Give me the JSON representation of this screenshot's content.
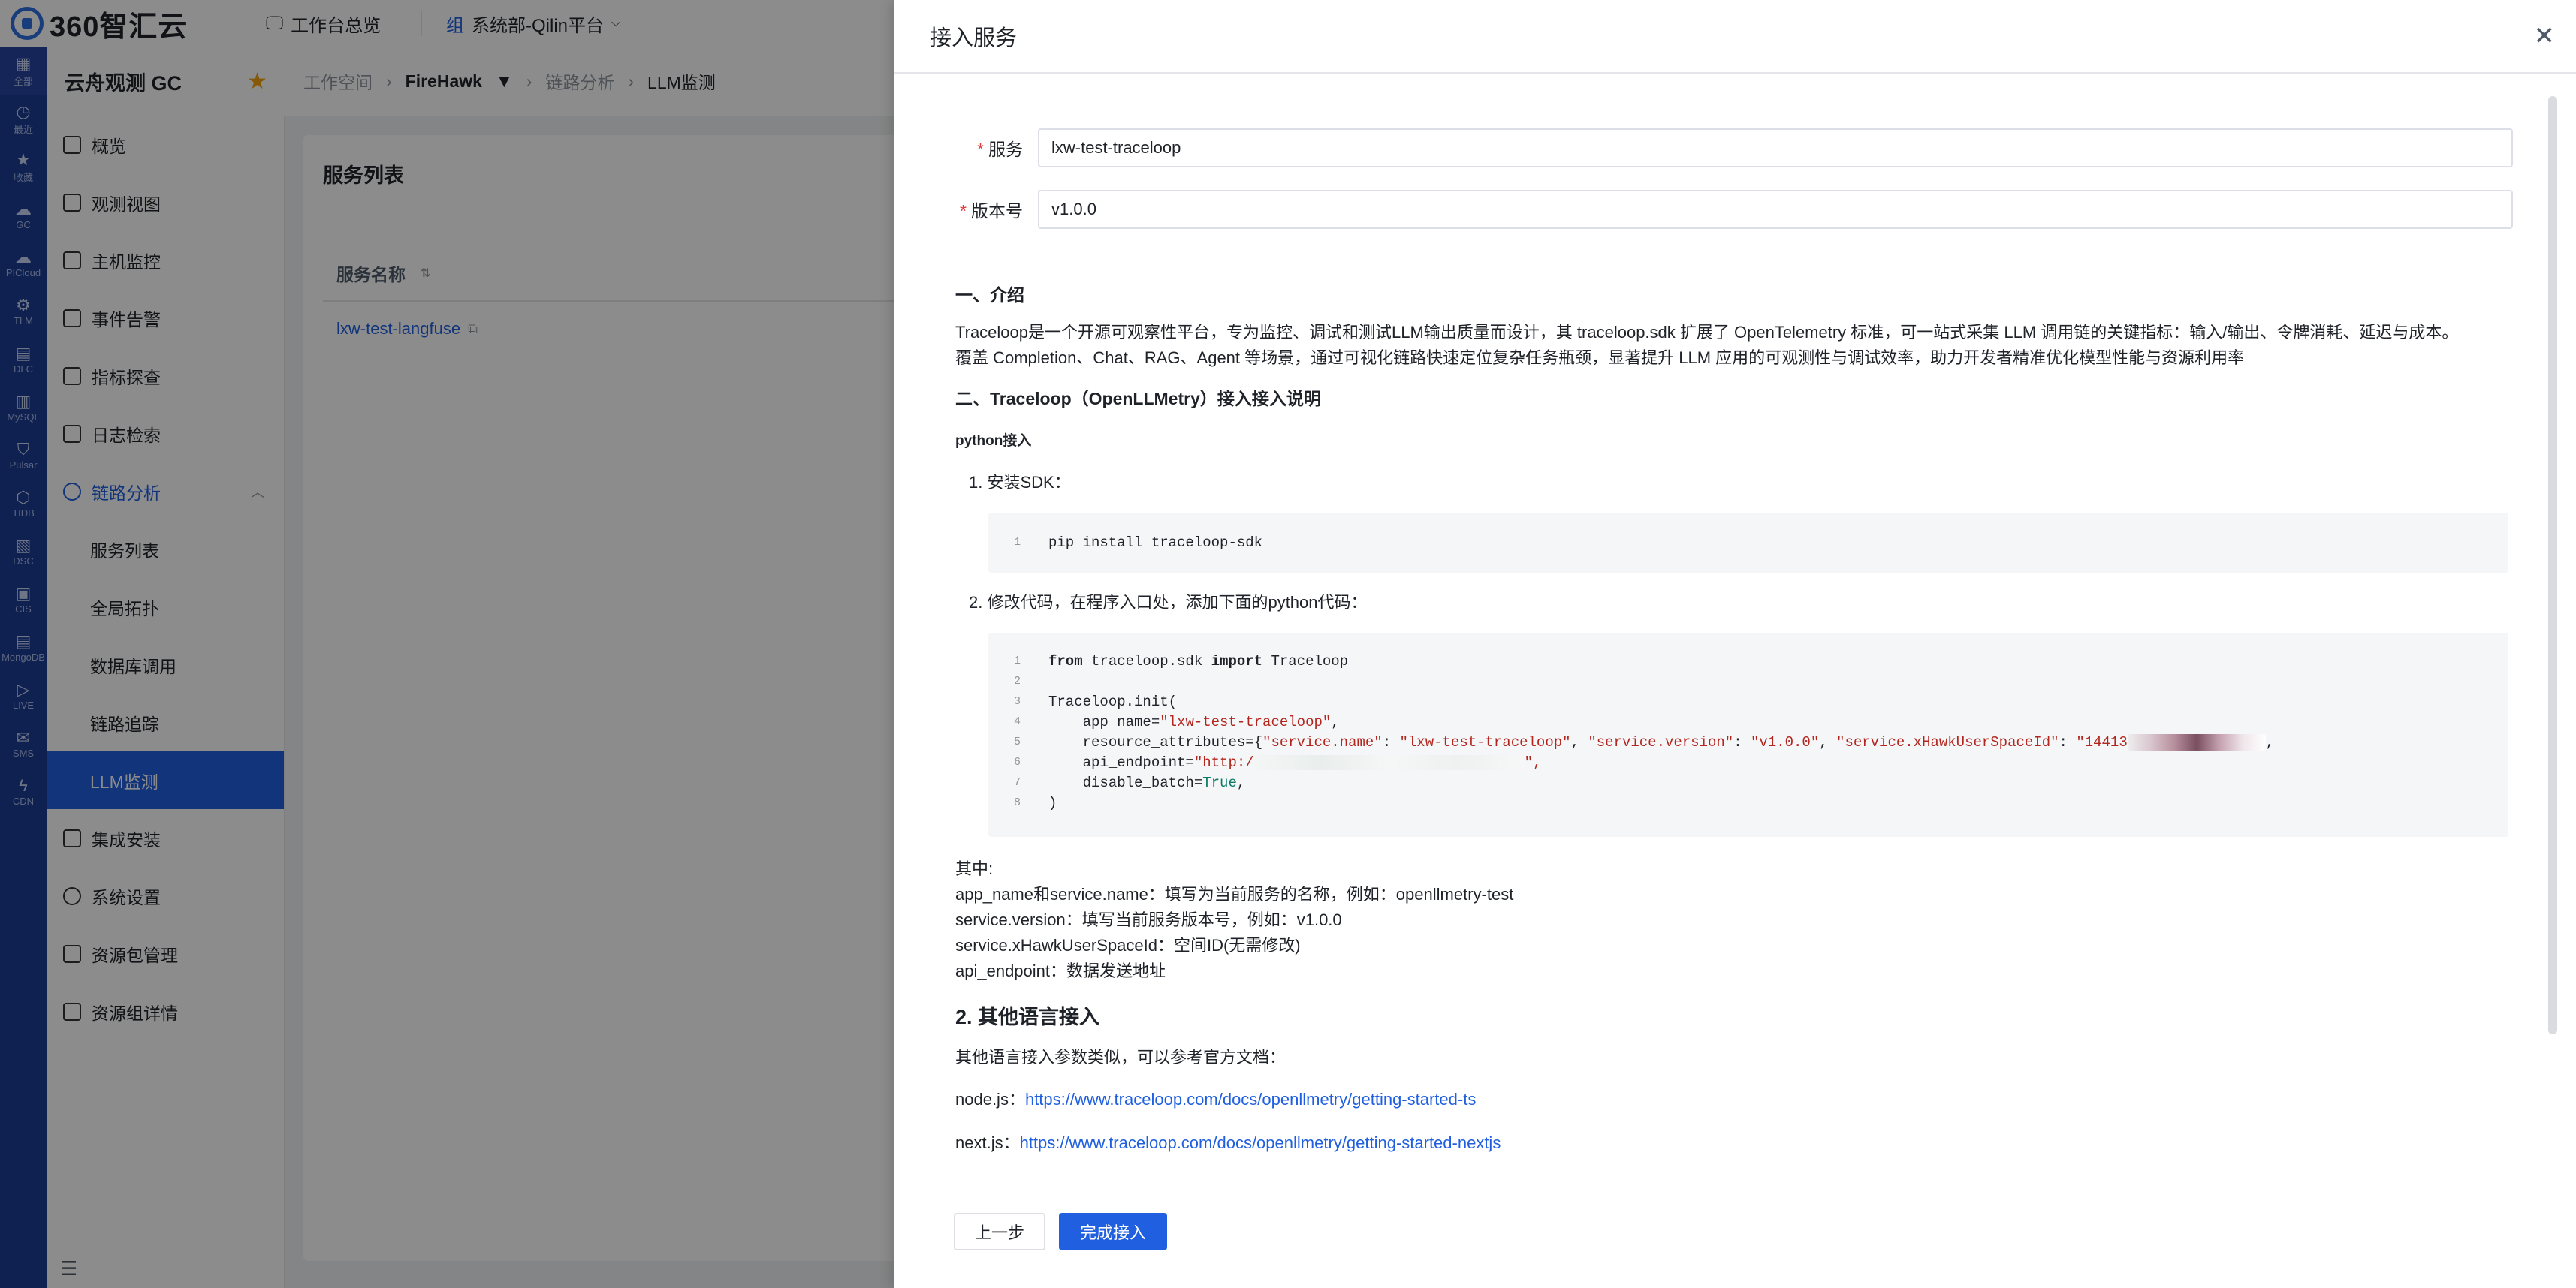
{
  "topbar": {
    "logo_text": "360智汇云",
    "workbench": "工作台总览",
    "dept": "系统部-Qilin平台"
  },
  "rail": [
    {
      "icon": "grid-icon",
      "label": "全部"
    },
    {
      "icon": "clock-icon",
      "label": "最近"
    },
    {
      "icon": "star-icon",
      "label": "收藏"
    },
    {
      "icon": "cloud-icon",
      "label": "GC"
    },
    {
      "icon": "cloud-icon",
      "label": "PICloud"
    },
    {
      "icon": "gear-icon",
      "label": "TLM"
    },
    {
      "icon": "db-icon",
      "label": "DLC"
    },
    {
      "icon": "db-icon",
      "label": "MySQL"
    },
    {
      "icon": "shield-icon",
      "label": "Pulsar"
    },
    {
      "icon": "cube-icon",
      "label": "TIDB"
    },
    {
      "icon": "chart-icon",
      "label": "DSC"
    },
    {
      "icon": "box-icon",
      "label": "CIS"
    },
    {
      "icon": "db-icon",
      "label": "MongoDB"
    },
    {
      "icon": "play-icon",
      "label": "LIVE"
    },
    {
      "icon": "message-icon",
      "label": "SMS"
    },
    {
      "icon": "bolt-icon",
      "label": "CDN"
    }
  ],
  "sidebar": {
    "title": "云舟观测 GC",
    "items": [
      "概览",
      "观测视图",
      "主机监控",
      "事件告警",
      "指标探查",
      "日志检索"
    ],
    "group": "链路分析",
    "subitems": [
      "服务列表",
      "全局拓扑",
      "数据库调用",
      "链路追踪",
      "LLM监测"
    ],
    "items_after": [
      "集成安装",
      "系统设置",
      "资源包管理",
      "资源组详情"
    ]
  },
  "main": {
    "crumbs": [
      "工作空间",
      "FireHawk",
      "链路分析",
      "LLM监测"
    ],
    "card_title": "服务列表",
    "col_service": "服务名称",
    "row_service": "lxw-test-langfuse"
  },
  "drawer": {
    "title": "接入服务",
    "service_label": "服务",
    "service_value": "lxw-test-traceloop",
    "version_label": "版本号",
    "version_value": "v1.0.0",
    "sec1_title": "一、介绍",
    "intro_1": "Traceloop是一个开源可观察性平台，专为监控、调试和测试LLM输出质量而设计，其 traceloop.sdk 扩展了 OpenTelemetry 标准，可一站式采集 LLM 调用链的关键指标：输入/输出、令牌消耗、延迟与成本。",
    "intro_2": "覆盖 Completion、Chat、RAG、Agent 等场景，通过可视化链路快速定位复杂任务瓶颈，显著提升 LLM 应用的可观测性与调试效率，助力开发者精准优化模型性能与资源利用率",
    "sec2_title": "二、Traceloop（OpenLLMetry）接入接入说明",
    "python_title": "python接入",
    "step1": "1. 安装SDK：",
    "code1": "pip install traceloop-sdk",
    "step2": "2. 修改代码，在程序入口处，添加下面的python代码：",
    "code2": {
      "l1_kw1": "from",
      "l1_mod": " traceloop.sdk ",
      "l1_kw2": "import",
      "l1_cls": " Traceloop",
      "l3": "Traceloop.init(",
      "l4_key": "    app_name=",
      "l4_val": "\"lxw-test-traceloop\"",
      "l5_key": "    resource_attributes={",
      "l5_s1": "\"service.name\"",
      "l5_s2": "\"lxw-test-traceloop\"",
      "l5_s3": "\"service.version\"",
      "l5_s4": "\"v1.0.0\"",
      "l5_s5": "\"service.xHawkUserSpaceId\"",
      "l5_s6": "\"14413",
      "l6_key": "    api_endpoint=",
      "l6_val": "\"http:/",
      "l6_end": "\",",
      "l7_key": "    disable_batch=",
      "l7_val": "True",
      "l8": ")"
    },
    "notes_title": "其中:",
    "note1": "app_name和service.name：填写为当前服务的名称，例如：openllmetry-test",
    "note2": "service.version：填写当前服务版本号，例如：v1.0.0",
    "note3": "service.xHawkUserSpaceId：空间ID(无需修改)",
    "note4": "api_endpoint：数据发送地址",
    "other_title": "2. 其他语言接入",
    "other_desc": "其他语言接入参数类似，可以参考官方文档：",
    "node_label": "node.js：",
    "node_url": "https://www.traceloop.com/docs/openllmetry/getting-started-ts",
    "next_label": "next.js：",
    "next_url": "https://www.traceloop.com/docs/openllmetry/getting-started-nextjs",
    "btn_prev": "上一步",
    "btn_finish": "完成接入"
  }
}
